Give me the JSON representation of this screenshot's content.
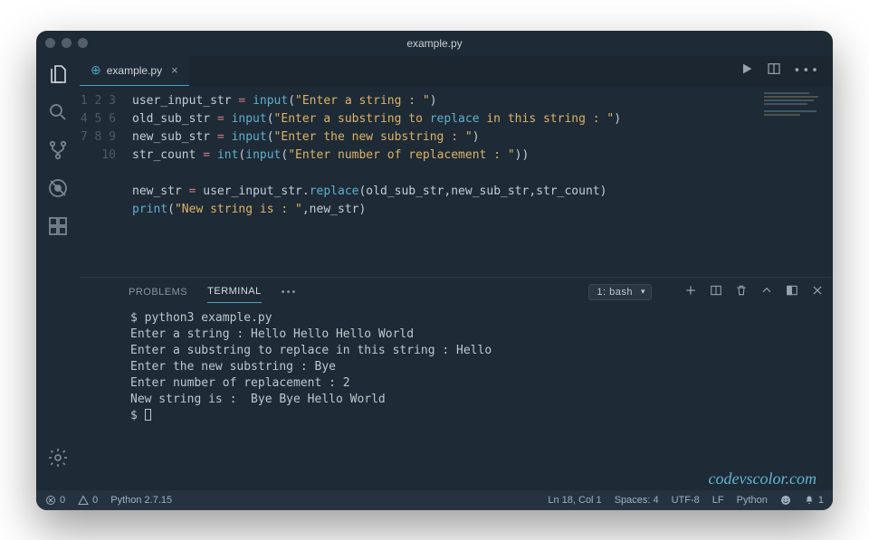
{
  "window": {
    "title": "example.py"
  },
  "tab": {
    "label": "example.py"
  },
  "code": {
    "lines": [
      {
        "n": 1,
        "raw": "user_input_str = input(\"Enter a string : \")"
      },
      {
        "n": 2,
        "raw": "old_sub_str = input(\"Enter a substring to replace in this string : \")"
      },
      {
        "n": 3,
        "raw": "new_sub_str = input(\"Enter the new substring : \")"
      },
      {
        "n": 4,
        "raw": "str_count = int(input(\"Enter number of replacement : \"))"
      },
      {
        "n": 5,
        "raw": ""
      },
      {
        "n": 6,
        "raw": "new_str = user_input_str.replace(old_sub_str,new_sub_str,str_count)"
      },
      {
        "n": 7,
        "raw": "print(\"New string is : \",new_str)"
      },
      {
        "n": 8,
        "raw": ""
      },
      {
        "n": 9,
        "raw": ""
      },
      {
        "n": 10,
        "raw": ""
      }
    ]
  },
  "panel": {
    "tabs": {
      "problems": "PROBLEMS",
      "terminal": "TERMINAL"
    },
    "dropdown": "1: bash"
  },
  "terminal": {
    "lines": [
      "$ python3 example.py",
      "Enter a string : Hello Hello Hello World",
      "Enter a substring to replace in this string : Hello",
      "Enter the new substring : Bye",
      "Enter number of replacement : 2",
      "New string is :  Bye Bye Hello World",
      "$ "
    ]
  },
  "watermark": "codevscolor.com",
  "status": {
    "errors": "0",
    "warnings": "0",
    "python_version": "Python 2.7.15",
    "cursor": "Ln 18, Col 1",
    "spaces": "Spaces: 4",
    "encoding": "UTF-8",
    "eol": "LF",
    "language": "Python",
    "notifications": "1"
  }
}
